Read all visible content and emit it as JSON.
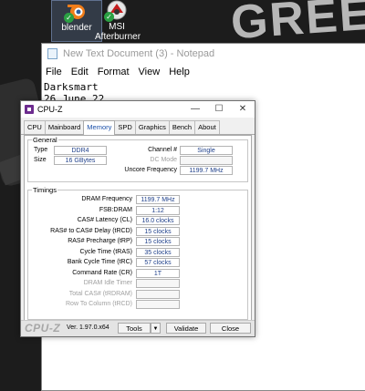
{
  "desktop": {
    "wallpaper_text": "GREE",
    "icons": [
      {
        "label": "blender",
        "icon": "blender-icon"
      },
      {
        "label": "MSI Afterburner",
        "icon": "msi-afterburner-icon"
      }
    ]
  },
  "notepad": {
    "title": "New Text Document (3) - Notepad",
    "menu": [
      "File",
      "Edit",
      "Format",
      "View",
      "Help"
    ],
    "lines": [
      "Darksmart",
      "26 June 22"
    ]
  },
  "cpuz": {
    "title": "CPU-Z",
    "tabs": [
      "CPU",
      "Mainboard",
      "Memory",
      "SPD",
      "Graphics",
      "Bench",
      "About"
    ],
    "active_tab": "Memory",
    "general": {
      "legend": "General",
      "type_label": "Type",
      "type_value": "DDR4",
      "size_label": "Size",
      "size_value": "16 GBytes",
      "channel_label": "Channel #",
      "channel_value": "Single",
      "dc_mode_label": "DC Mode",
      "dc_mode_value": "",
      "uncore_label": "Uncore Frequency",
      "uncore_value": "1199.7 MHz"
    },
    "timings": {
      "legend": "Timings",
      "rows": [
        {
          "label": "DRAM Frequency",
          "value": "1199.7 MHz",
          "enabled": true
        },
        {
          "label": "FSB:DRAM",
          "value": "1:12",
          "enabled": true
        },
        {
          "label": "CAS# Latency (CL)",
          "value": "16.0 clocks",
          "enabled": true
        },
        {
          "label": "RAS# to CAS# Delay (tRCD)",
          "value": "15 clocks",
          "enabled": true
        },
        {
          "label": "RAS# Precharge (tRP)",
          "value": "15 clocks",
          "enabled": true
        },
        {
          "label": "Cycle Time (tRAS)",
          "value": "35 clocks",
          "enabled": true
        },
        {
          "label": "Bank Cycle Time (tRC)",
          "value": "57 clocks",
          "enabled": true
        },
        {
          "label": "Command Rate (CR)",
          "value": "1T",
          "enabled": true
        },
        {
          "label": "DRAM Idle Timer",
          "value": "",
          "enabled": false
        },
        {
          "label": "Total CAS# (tRDRAM)",
          "value": "",
          "enabled": false
        },
        {
          "label": "Row To Column (tRCD)",
          "value": "",
          "enabled": false
        }
      ]
    },
    "footer": {
      "brand": "CPU-Z",
      "version": "Ver. 1.97.0.x64",
      "tools_label": "Tools",
      "validate_label": "Validate",
      "close_label": "Close"
    },
    "window_controls": {
      "minimize": "—",
      "maximize": "☐",
      "close": "✕"
    }
  }
}
